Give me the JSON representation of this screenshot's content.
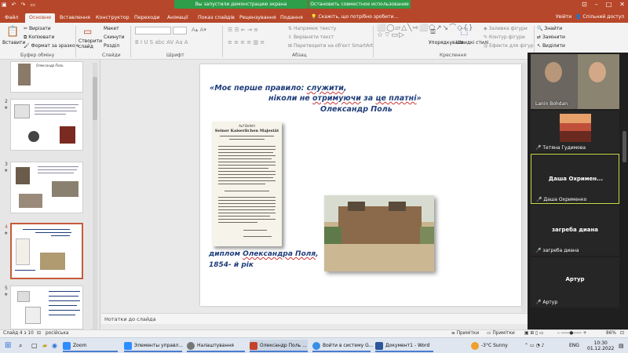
{
  "titlebar": {
    "screen_share": "Вы запустили демонстрацию экрана",
    "stop_share": "Остановить совместное использование",
    "account": "Увійти",
    "shared_access": "Спільний доступ"
  },
  "tabs": [
    "Файл",
    "Основне",
    "Вставлення",
    "Конструктор",
    "Переходи",
    "Анімації",
    "Показ слайдів",
    "Рецензування",
    "Подання"
  ],
  "active_tab": "Основне",
  "search_placeholder": "Скажіть, що потрібно зробити...",
  "ribbon": {
    "paste": "Вставити",
    "cut": "Вирізати",
    "copy": "Копіювати",
    "format_painter": "Формат за зразком",
    "clipboard_group": "Буфер обміну",
    "new_slide": "Створити слайд",
    "layout": "Макет",
    "reset": "Скинути",
    "section": "Розділ",
    "slides_group": "Слайди",
    "font_group": "Шрифт",
    "text_direction": "Напрямок тексту",
    "align_text": "Вирівняти текст",
    "smartart": "Перетворити на об'єкт SmartArt",
    "paragraph_group": "Абзац",
    "arrange": "Упорядкувати",
    "quick_styles": "Швидкі стилі",
    "shape_fill": "Заливка фігури",
    "shape_outline": "Контур фігури",
    "shape_effects": "Ефекти для фігур",
    "drawing_group": "Креслення",
    "find": "Знайти",
    "replace": "Замінити",
    "select": "Виділити",
    "editing_group": "Редагування"
  },
  "thumbnails": [
    {
      "num": "",
      "caption": "Олександр Поль"
    },
    {
      "num": "2"
    },
    {
      "num": "3"
    },
    {
      "num": "4",
      "selected": true
    },
    {
      "num": "5"
    }
  ],
  "slide": {
    "quote_start": "«",
    "quote_line1a": "Моє перше правило: ",
    "quote_line1b": "служити",
    "quote_line1c": ",",
    "quote_line2a": "ніколи не ",
    "quote_line2b": "отримуючи",
    "quote_line2c": " за ",
    "quote_line2d": "це платні",
    "quote_end": "»",
    "author": "Олександр Поль",
    "doc_header1": "Auf Befehl",
    "doc_header2": "Seiner Kaiserlichen Majestät",
    "caption_line1a": "диплом ",
    "caption_line1b": "Олександра Поля",
    "caption_line1c": ",",
    "caption_line2": "1854- й рік"
  },
  "notes_placeholder": "Нотатки до слайда",
  "status": {
    "slide_of": "Слайд 4 з 10",
    "language": "російська",
    "notes": "Примітки",
    "comments": "Примітки",
    "zoom": "86%"
  },
  "participants": [
    {
      "name": "Lanin Bohdan",
      "type": "video"
    },
    {
      "name": "Тетяна Гудимова",
      "type": "image"
    },
    {
      "name": "Даша Охрименко",
      "display": "Даша  Охримен...",
      "type": "name"
    },
    {
      "name": "загреба диана",
      "display": "загреба диана",
      "type": "name"
    },
    {
      "name": "Артур",
      "display": "Артур",
      "type": "name"
    }
  ],
  "taskbar": {
    "items": [
      "Zoom",
      "Элементы управл...",
      "Налаштування",
      "Олександр Поль ...",
      "Войти в систему G...",
      "Документ1 - Word"
    ],
    "weather": "-3°C  Sunny",
    "lang": "ENG",
    "time": "10:30",
    "date": "01.12.2022"
  },
  "colors": {
    "accent": "#b7472a",
    "slide_text": "#1f3d7a",
    "share_green": "#2e9e4b"
  }
}
